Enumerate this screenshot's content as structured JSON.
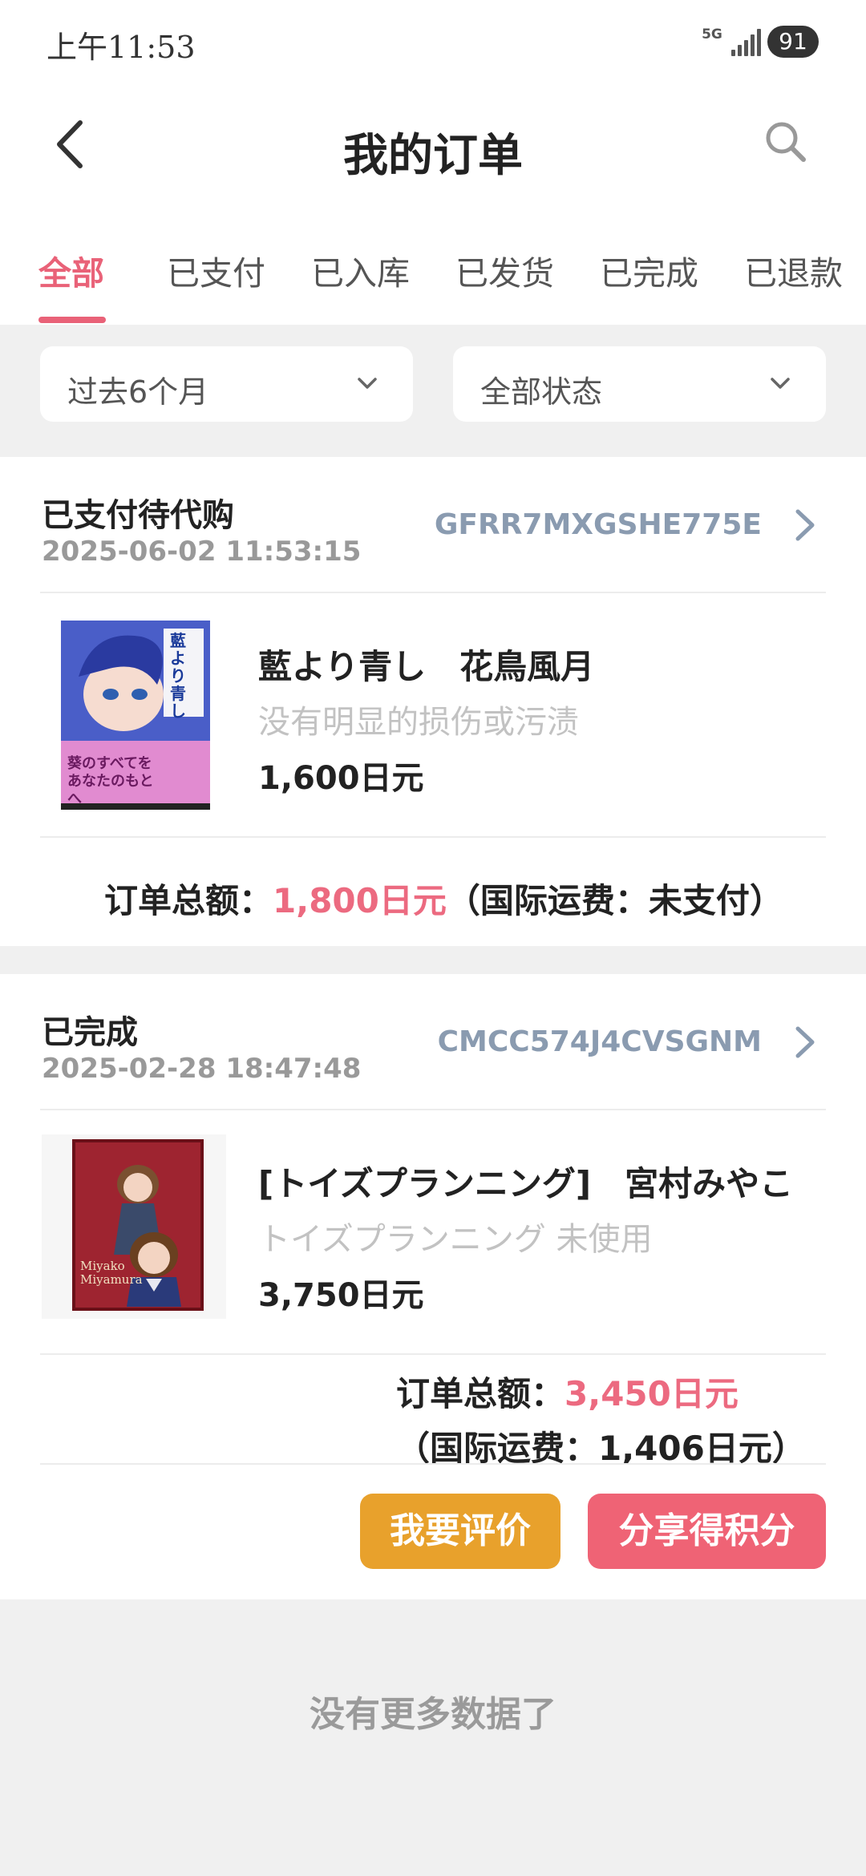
{
  "status_bar": {
    "time": "上午11:53",
    "network": "5G",
    "battery": "91"
  },
  "header": {
    "title": "我的订单"
  },
  "tabs": [
    {
      "label": "全部",
      "active": true
    },
    {
      "label": "已支付"
    },
    {
      "label": "已入库"
    },
    {
      "label": "已发货"
    },
    {
      "label": "已完成"
    },
    {
      "label": "已退款"
    }
  ],
  "filters": {
    "period": "过去6个月",
    "status": "全部状态"
  },
  "orders": [
    {
      "status": "已支付待代购",
      "date": "2025-06-02 11:53:15",
      "order_id": "GFRR7MXGSHE775E",
      "item": {
        "name": "藍より青し　花鳥風月",
        "condition": "没有明显的损伤或污渍",
        "price": "1,600日元",
        "thumb_title": "藍より青し",
        "thumb_text": "葵のすべてを あなたのもとへ"
      },
      "total_label": "订单总额：",
      "total_value": "1,800日元",
      "shipping": "（国际运费：未支付）"
    },
    {
      "status": "已完成",
      "date": "2025-02-28 18:47:48",
      "order_id": "CMCC574J4CVSGNM",
      "item": {
        "name": "[トイズプランニング]　宮村みやこ",
        "condition": "トイズプランニング 未使用",
        "price": "3,750日元",
        "thumb_text": "Miyako Miyamura"
      },
      "total_label": "订单总额：",
      "total_value": "3,450日元",
      "shipping": "（国际运费：1,406日元）",
      "buttons": {
        "review": "我要评价",
        "share": "分享得积分"
      }
    }
  ],
  "footer": {
    "no_more": "没有更多数据了"
  },
  "colors": {
    "accent": "#e96278",
    "review_button": "#e8a12c",
    "share_button": "#ef6375",
    "order_id": "#8a9bb0"
  },
  "icons": [
    "back-arrow-icon",
    "search-icon",
    "chevron-down-icon",
    "chevron-right-icon",
    "signal-icon",
    "battery-icon"
  ]
}
